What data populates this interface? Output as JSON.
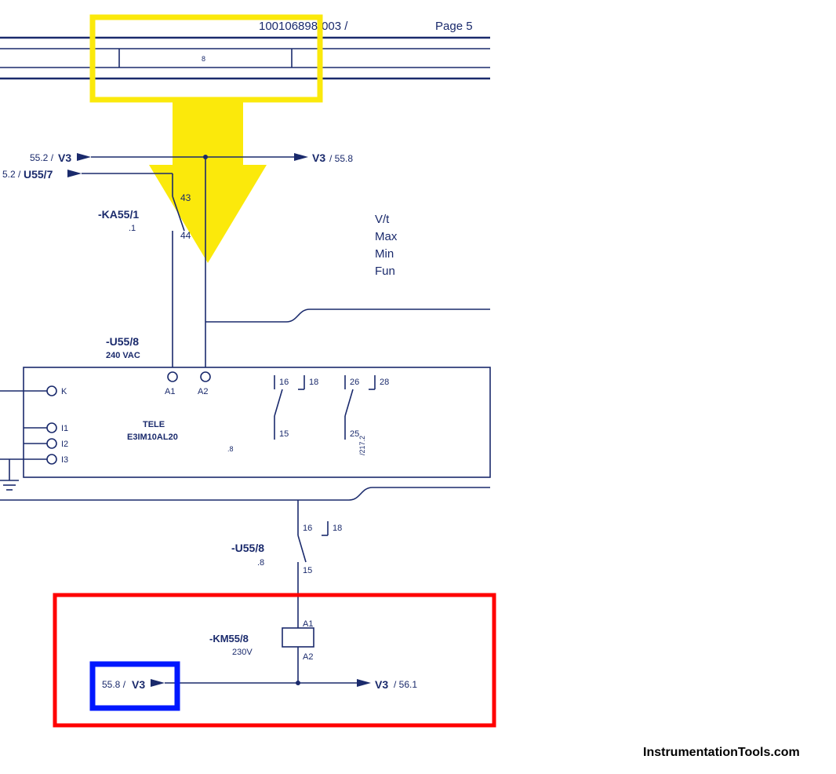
{
  "header": {
    "doc_no": "100106898-003 /",
    "page_label": "Page 5",
    "column_label": "8"
  },
  "bus_refs": {
    "v3_in_top": {
      "page_ref": "55.2 /",
      "signal": "V3"
    },
    "v3_out_top": {
      "signal": "V3",
      "page_ref": "/ 55.8"
    },
    "u55_7_in": {
      "page_ref": "5.2 /",
      "signal": "U55/7"
    },
    "v3_in_bot": {
      "page_ref": "55.8 /",
      "signal": "V3"
    },
    "v3_out_bot": {
      "signal": "V3",
      "page_ref": "/ 56.1"
    }
  },
  "components": {
    "ka55_1": {
      "tag": "-KA55/1",
      "subref": ".1",
      "term_top": "43",
      "term_bot": "44"
    },
    "u55_8_device": {
      "tag": "-U55/8",
      "voltage": "240 VAC",
      "make_line1": "TELE",
      "make_line2": "E3IM10AL20",
      "subref": ".8",
      "terminals": {
        "k": "K",
        "i1": "I1",
        "i2": "I2",
        "i3": "I3",
        "a1": "A1",
        "a2": "A2",
        "c15": "15",
        "c16": "16",
        "c18": "18",
        "c25": "25",
        "c26": "26",
        "c28": "28"
      },
      "side_ref": "/217.2"
    },
    "u55_8_contact": {
      "tag": "-U55/8",
      "subref": ".8",
      "t15": "15",
      "t16": "16",
      "t18": "18"
    },
    "km55_8": {
      "tag": "-KM55/8",
      "voltage": "230V",
      "a1": "A1",
      "a2": "A2"
    }
  },
  "notes": {
    "n1": "V/t",
    "n2": "Max",
    "n3": "Min",
    "n4": "Fun"
  },
  "watermark": "InstrumentationTools.com"
}
